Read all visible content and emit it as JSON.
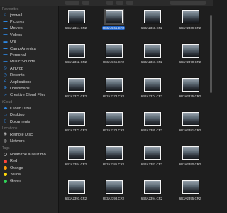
{
  "sidebar": {
    "favourites_header": "Favourites",
    "favourites": [
      {
        "label": "jonwall",
        "icon": "home-icon"
      },
      {
        "label": "Pictures",
        "icon": "folder-icon"
      },
      {
        "label": "Movies",
        "icon": "folder-icon"
      },
      {
        "label": "Videos",
        "icon": "folder-icon"
      },
      {
        "label": "Uni",
        "icon": "folder-icon"
      },
      {
        "label": "Camp America",
        "icon": "folder-icon"
      },
      {
        "label": "Personal",
        "icon": "folder-icon"
      },
      {
        "label": "Music/Sounds",
        "icon": "folder-icon"
      },
      {
        "label": "AirDrop",
        "icon": "airdrop-icon"
      },
      {
        "label": "Recents",
        "icon": "clock-icon"
      },
      {
        "label": "Applications",
        "icon": "applications-icon"
      },
      {
        "label": "Downloads",
        "icon": "download-icon"
      },
      {
        "label": "Creative Cloud Files",
        "icon": "creative-cloud-icon"
      }
    ],
    "icloud_header": "iCloud",
    "icloud": [
      {
        "label": "iCloud Drive",
        "icon": "cloud-icon"
      },
      {
        "label": "Desktop",
        "icon": "desktop-icon"
      },
      {
        "label": "Documents",
        "icon": "document-icon"
      }
    ],
    "locations_header": "Locations",
    "locations": [
      {
        "label": "Remote Disc",
        "icon": "disc-icon"
      },
      {
        "label": "Network",
        "icon": "network-icon"
      }
    ],
    "tags_header": "Tags",
    "tags": [
      {
        "label": "Nolan the auteur mo...",
        "color": "#8e8e8e"
      },
      {
        "label": "Red",
        "color": "#ff453a"
      },
      {
        "label": "Orange",
        "color": "#ff9f0a"
      },
      {
        "label": "Yellow",
        "color": "#ffd60a"
      },
      {
        "label": "Green",
        "color": "#30d158"
      }
    ]
  },
  "files": [
    "6B3A2364.CR2",
    "6B3A2366.CR2",
    "6B3A2368.CR2",
    "6B3A2369.CR2",
    "6B3A2362.CR2",
    "6B3A2365.CR2",
    "6B3A2367.CR2",
    "6B3A2370.CR2",
    "6B3A2372.CR2",
    "6B3A2373.CR2",
    "6B3A2374.CR2",
    "6B3A2375.CR2",
    "6B3A2377.CR2",
    "6B3A2378.CR2",
    "6B3A2380.CR2",
    "6B3A2381.CR2",
    "6B3A2384.CR2",
    "6B3A2385.CR2",
    "6B3A2387.CR2",
    "6B3A2390.CR2",
    "6B3A2391.CR2",
    "6B3A2393.CR2",
    "6B3A2394.CR2",
    "6B3A2395.CR2"
  ],
  "selected_file": "6B3A2366.CR2",
  "colors": {
    "accent": "#1f63c8",
    "sidebar_icon": "#2d87e2"
  }
}
